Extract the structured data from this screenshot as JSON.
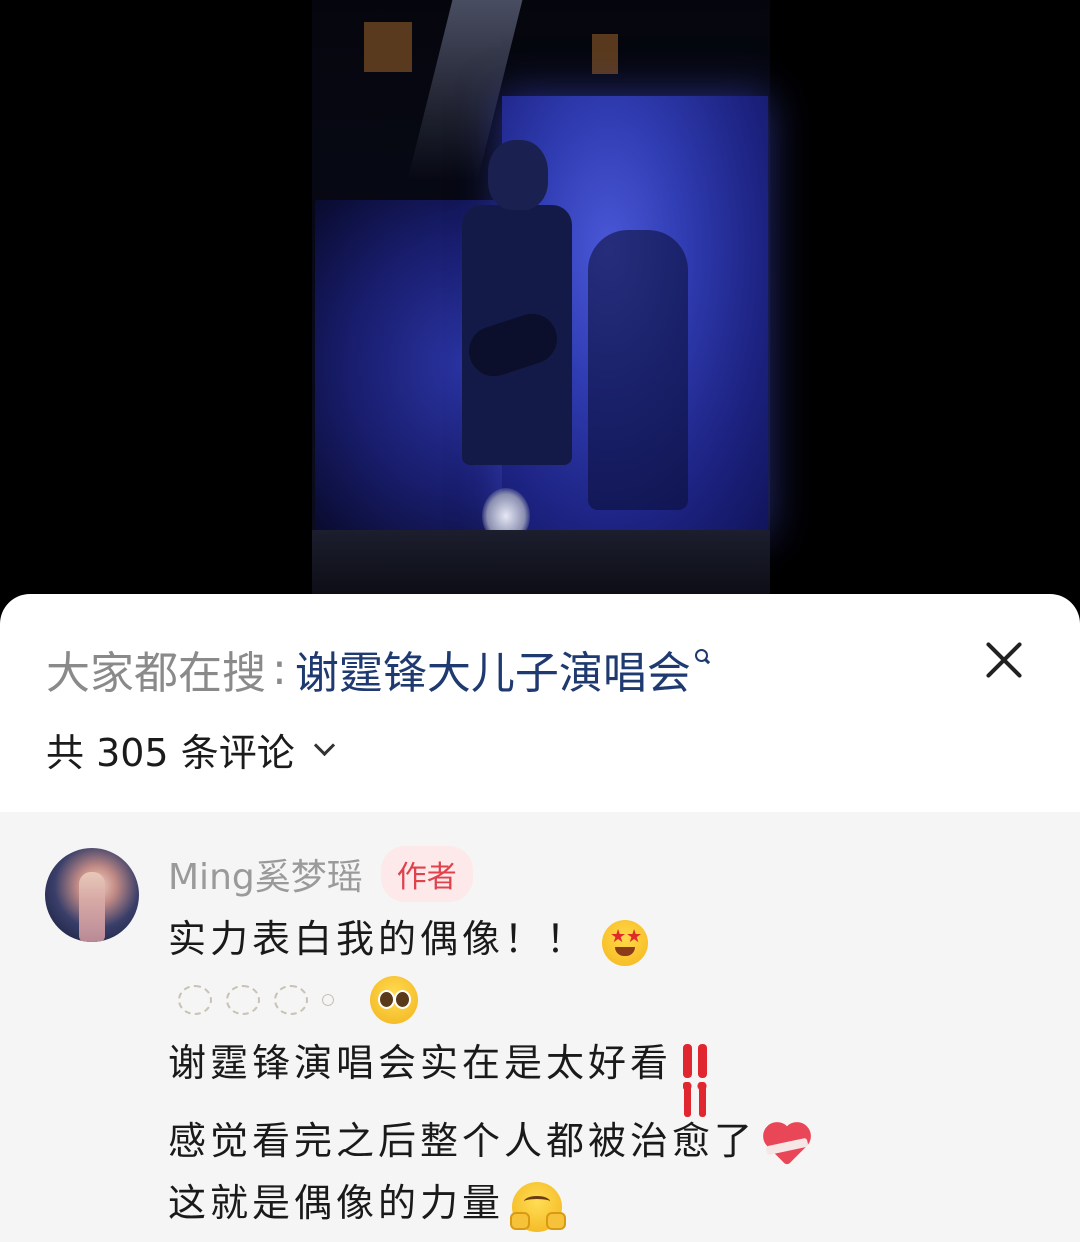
{
  "search": {
    "prefix": "大家都在搜",
    "separator": ":",
    "term": "谢霆锋大儿子演唱会"
  },
  "comments_header": {
    "count_label": "共 305 条评论"
  },
  "comment": {
    "username": "Ming奚梦瑶",
    "badge": "作者",
    "lines": [
      "实力表白我的偶像！！",
      "谢霆锋演唱会实在是太好看",
      "感觉看完之后整个人都被治愈了",
      "这就是偶像的力量"
    ],
    "emojis": [
      "star-struck",
      "pleading-face",
      "double-exclamation",
      "mending-heart",
      "hugging-face"
    ]
  },
  "colors": {
    "search_term": "#1f3a70",
    "badge_text": "#e0424d",
    "badge_bg": "#fde9ea",
    "username": "#9a9a9a"
  }
}
